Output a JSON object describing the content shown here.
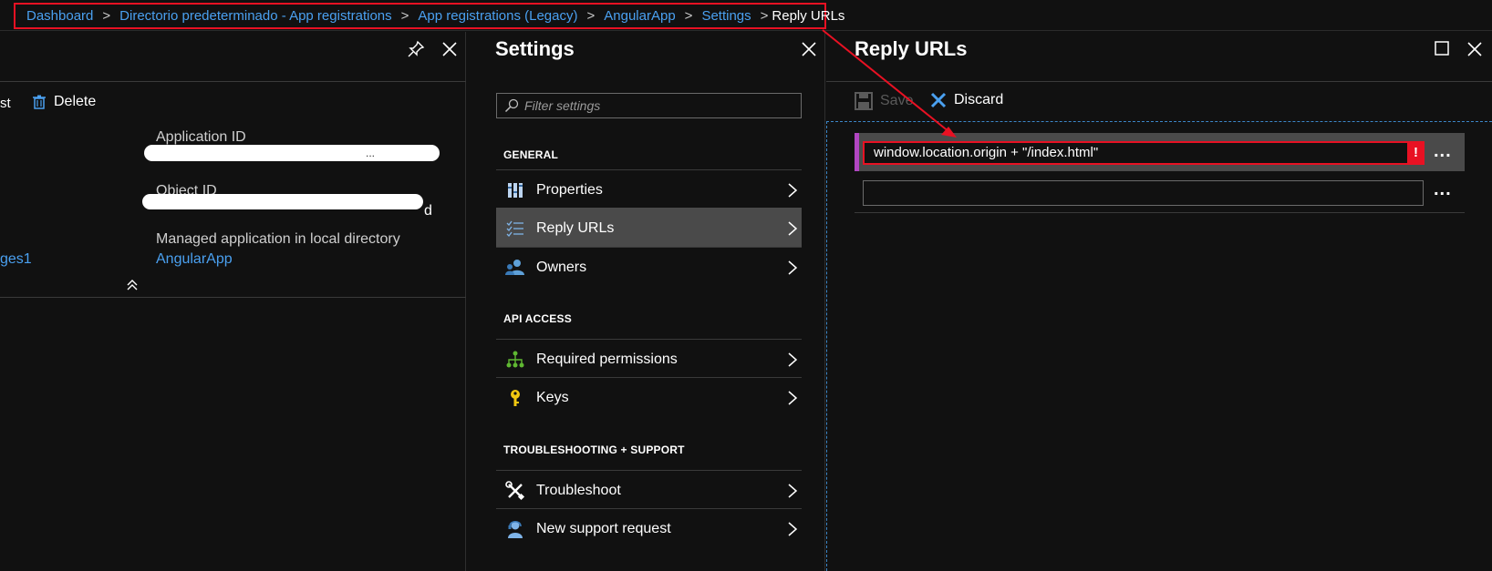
{
  "breadcrumb": {
    "items": [
      "Dashboard",
      "Directorio predeterminado - App registrations",
      "App registrations (Legacy)",
      "AngularApp",
      "Settings"
    ],
    "current": "Reply URLs"
  },
  "left_blade": {
    "toolbar_partial": "st",
    "delete_label": "Delete",
    "app_id_label": "Application ID",
    "app_id_partial": "...",
    "object_id_label": "Object ID",
    "object_id_partial": "d",
    "managed_label": "Managed application in local directory",
    "managed_link": "AngularApp",
    "left_link_partial": "ges1"
  },
  "settings_blade": {
    "title": "Settings",
    "filter_placeholder": "Filter settings",
    "sections": [
      {
        "header": "GENERAL",
        "items": [
          "Properties",
          "Reply URLs",
          "Owners"
        ]
      },
      {
        "header": "API ACCESS",
        "items": [
          "Required permissions",
          "Keys"
        ]
      },
      {
        "header": "TROUBLESHOOTING + SUPPORT",
        "items": [
          "Troubleshoot",
          "New support request"
        ]
      }
    ],
    "selected_item": "Reply URLs"
  },
  "reply_blade": {
    "title": "Reply URLs",
    "save_label": "Save",
    "discard_label": "Discard",
    "urls": [
      "window.location.origin + \"/index.html\"",
      ""
    ],
    "error_mark": "!",
    "more_label": "..."
  },
  "colors": {
    "background": "#111111",
    "link": "#4aa0f0",
    "error": "#e81123",
    "selected": "#4a4a4a",
    "row_accent": "#b146c2"
  }
}
